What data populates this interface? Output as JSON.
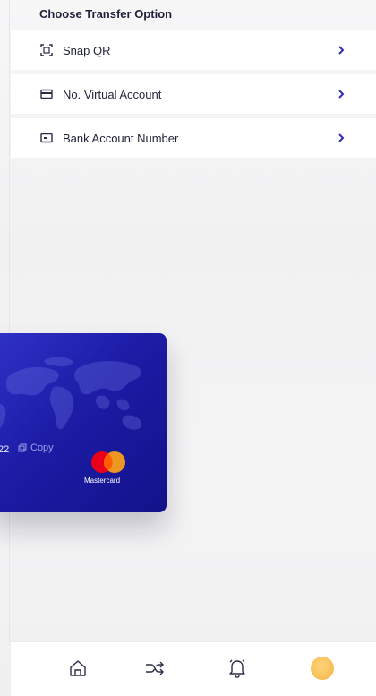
{
  "header": {
    "title": "Choose Transfer Option"
  },
  "options": [
    {
      "label": "Snap QR",
      "icon": "scan-qr-icon"
    },
    {
      "label": "No. Virtual Account",
      "icon": "card-icon"
    },
    {
      "label": "Bank Account Number",
      "icon": "bank-card-icon"
    }
  ],
  "card": {
    "number_fragment": "22",
    "copy_label": "Copy",
    "brand_label": "Mastercard",
    "colors": {
      "card_start": "#3032c8",
      "card_end": "#12128a",
      "mc_red": "#eb001b",
      "mc_yellow": "#f79e1b"
    }
  },
  "bottom_nav": {
    "items": [
      {
        "name": "home",
        "icon": "home-icon"
      },
      {
        "name": "transfer",
        "icon": "shuffle-icon"
      },
      {
        "name": "notifications",
        "icon": "bell-icon"
      },
      {
        "name": "profile",
        "icon": "avatar"
      }
    ]
  },
  "accent_color": "#2b2bb3"
}
